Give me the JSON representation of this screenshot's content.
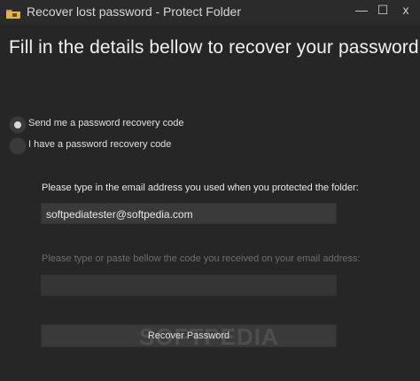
{
  "window": {
    "title": "Recover lost password - Protect Folder",
    "controls": {
      "minimize": "—",
      "maximize": "☐",
      "close": "x"
    }
  },
  "main": {
    "heading": "Fill in the details bellow to recover your password",
    "radios": [
      {
        "label": "Send me a password recovery code",
        "checked": true
      },
      {
        "label": "I have a password recovery code",
        "checked": false
      }
    ],
    "email_label": "Please type in the email address you used when you protected the folder:",
    "email_value": "softpediatester@softpedia.com",
    "code_label": "Please type or paste bellow the code you received on your email address:",
    "code_value": "",
    "recover_button": "Recover Password",
    "watermark": "SOFTPEDIA"
  }
}
